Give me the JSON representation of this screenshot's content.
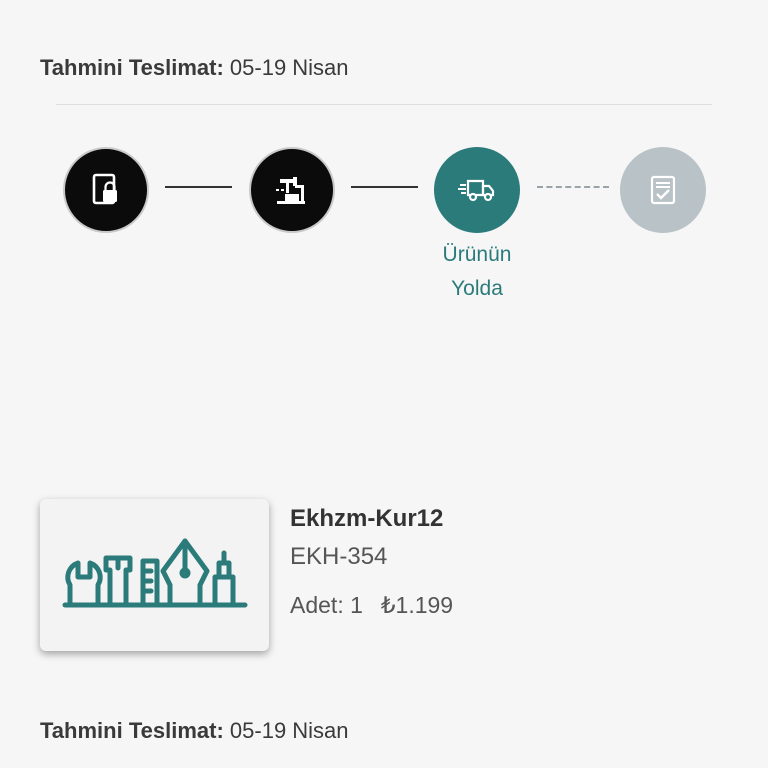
{
  "order": [
    {
      "delivery_label": "Tahmini Teslimat:",
      "delivery_value": "05-19 Nisan"
    }
  ],
  "tracker": {
    "steps": [
      {
        "icon": "order-lock-icon",
        "state": "done"
      },
      {
        "icon": "production-icon",
        "state": "done"
      },
      {
        "icon": "truck-icon",
        "state": "active",
        "label_line1": "Ürünün",
        "label_line2": "Yolda"
      },
      {
        "icon": "checklist-icon",
        "state": "pending"
      }
    ]
  },
  "product": {
    "name": "Ekhzm-Kur12",
    "code": "EKH-354",
    "qty_label": "Adet: 1",
    "price": "₺1.199",
    "image_icon": "tools-icon"
  },
  "next_order": {
    "delivery_label": "Tahmini Teslimat:",
    "delivery_value": "05-19 Nisan"
  },
  "colors": {
    "accent": "#2b7b7b",
    "done": "#0b0b0b",
    "pending": "#b9c2c6",
    "background": "#f6f6f6"
  }
}
